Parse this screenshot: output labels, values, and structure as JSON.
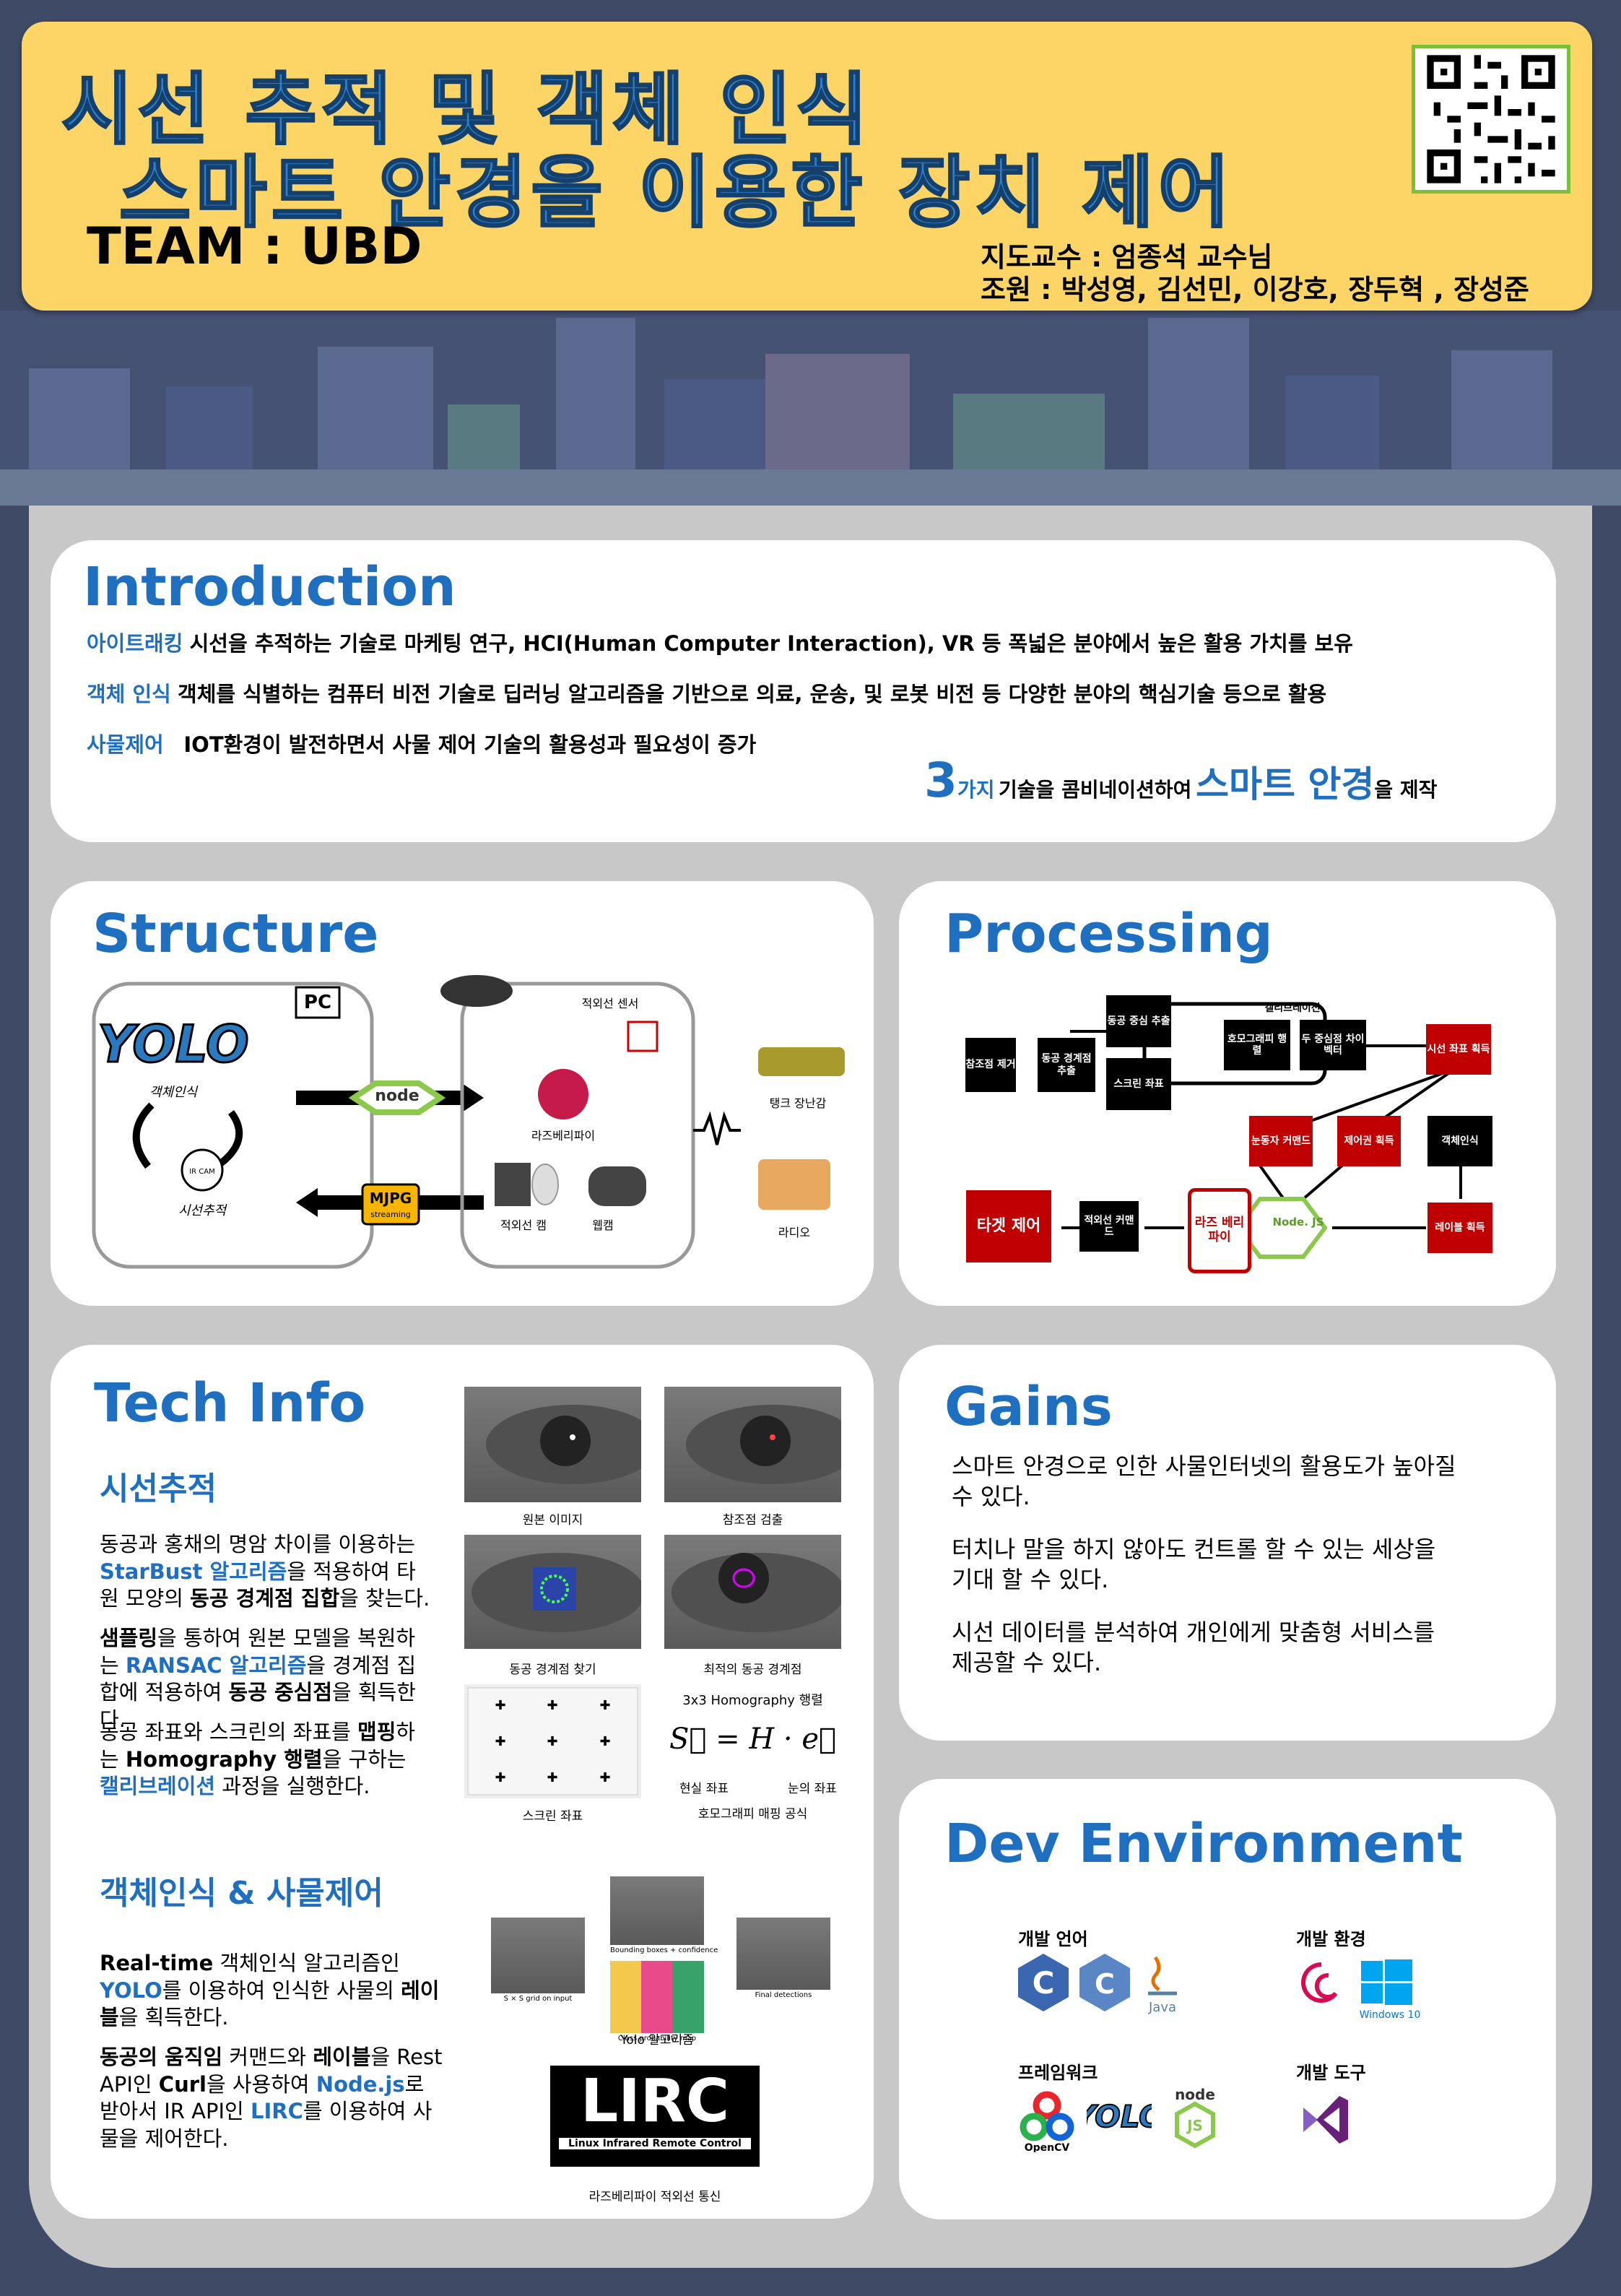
{
  "header": {
    "title_line1": "시선 추적 및 객체 인식",
    "title_line2": "스마트 안경을 이용한 장치 제어",
    "team": "TEAM : UBD",
    "advisor": "지도교수 : 엄종석 교수님",
    "members": "조원 : 박성영, 김선민, 이강호, 장두혁 , 장성준"
  },
  "introduction": {
    "heading": "Introduction",
    "items": [
      {
        "term": "아이트래킹",
        "text": "시선을 추적하는 기술로 마케팅 연구, HCI(Human Computer Interaction), VR 등 폭넓은 분야에서 높은 활용 가치를 보유"
      },
      {
        "term": "객체 인식",
        "text": "객체를 식별하는 컴퓨터 비전 기술로 딥러닝 알고리즘을 기반으로 의료, 운송, 및 로봇 비전 등 다양한 분야의 핵심기술 등으로 활용"
      },
      {
        "term": "사물제어",
        "text": "IOT환경이 발전하면서 사물 제어 기술의 활용성과 필요성이 증가"
      }
    ],
    "summary": {
      "num": "3",
      "unit": "가지",
      "text1": "기술을 콤비네이션하여",
      "highlight": "스마트 안경",
      "text2": "을 제작"
    }
  },
  "structure": {
    "heading": "Structure",
    "pc_label": "PC",
    "yolo_label": "YOLO",
    "object_label": "객체인식",
    "ir_cam_label": "IR CAM",
    "gaze_label": "시선추적",
    "node_label": "node",
    "mjpg_label": "MJPG",
    "mjpg_sub": "streaming",
    "ir_sensor_label": "적외선 센서",
    "raspberry_label": "라즈베리파이",
    "ir_cam2_label": "적외선 캠",
    "webcam_label": "웹캠",
    "tank_label": "탱크 장난감",
    "radio_label": "라디오"
  },
  "processing": {
    "heading": "Processing",
    "boxes": {
      "ref": "참조점 제거",
      "edge": "동공 경계점 추출",
      "center": "동공 중심 추출",
      "screen": "스크린 좌표",
      "calib": "캘리브레이션",
      "homo": "호모그래피 행렬",
      "diff": "두 중심점 차이 벡터",
      "gaze_coord": "시선 좌표 획득",
      "eye_cmd": "눈동자 커맨드",
      "ctrl": "제어권 획득",
      "obj": "객체인식",
      "label": "레이블 획득",
      "node": "Node. JS",
      "rpi": "라즈 베리 파이",
      "ir_cmd": "적외선 커맨드",
      "target": "타겟 제어"
    }
  },
  "tech": {
    "heading": "Tech Info",
    "sub1": "시선추적",
    "p1": [
      " 동공과 홍채의 명암 차이를 이용하는 ",
      "StarBust 알고리즘",
      "을 적용하여 타원 모양의 ",
      "동공 경계점 집합",
      "을 찾는다."
    ],
    "p2": [
      " ",
      "샘플링",
      "을 통하여 원본 모델을 복원하는 ",
      "RANSAC 알고리즘",
      "을 경계점 집합에 적용하여 ",
      "동공 중심점",
      "을 획득한다."
    ],
    "p3": [
      " 동공 좌표와 스크린의 좌표를 ",
      "맵핑",
      "하는 ",
      "Homography 행렬",
      "을 구하는 ",
      "캘리브레이션",
      " 과정을 실행한다."
    ],
    "captions": [
      "원본 이미지",
      "참조점 검출",
      "동공 경계점 찾기",
      "최적의 동공 경계점",
      "스크린 좌표",
      "호모그래피 매핑 공식"
    ],
    "homography_title": "3x3 Homography 행렬",
    "formula": "S⃗ = H · e⃗",
    "formula_left": "현실 좌표",
    "formula_right": "눈의 좌표",
    "sub2": "객체인식 & 사물제어",
    "p4": [
      " ",
      "Real-time",
      " 객체인식 알고리즘인 ",
      "YOLO",
      "를 이용하여 인식한 사물의 ",
      "레이블",
      "을 획득한다."
    ],
    "p5": [
      " ",
      "동공의 움직임",
      " 커맨드와 ",
      "레이블",
      "을 Rest API인 ",
      "Curl",
      "을 사용하여 ",
      "Node.js",
      "로 받아서 IR API인 ",
      "LIRC",
      "를 이용하여 사물을 제어한다."
    ],
    "yolo_caption": "Yolo 알고리즘",
    "yolo_small": [
      "S × S grid on input",
      "Bounding boxes + confidence",
      "Class probability map",
      "Final detections"
    ],
    "lirc_title": "LIRC",
    "lirc_sub": "Linux Infrared Remote Control",
    "lirc_caption": "라즈베리파이 적외선 통신"
  },
  "gains": {
    "heading": "Gains",
    "items": [
      " 스마트 안경으로 인한 사물인터넷의 활용도가 높아질 수 있다.",
      " 터치나 말을 하지 않아도 컨트롤 할 수 있는 세상을 기대 할 수 있다.",
      " 시선 데이터를 분석하여 개인에게 맞춤형 서비스를 제공할 수 있다."
    ]
  },
  "dev": {
    "heading": "Dev Environment",
    "lang_label": "개발 언어",
    "env_label": "개발 환경",
    "fw_label": "프레임워크",
    "tool_label": "개발 도구",
    "java": "Java",
    "win10": "Windows 10",
    "opencv": "OpenCV",
    "yolo": "YOLO",
    "node": "node"
  },
  "colors": {
    "accent_blue": "#1f6fc0",
    "header_yellow": "#fdd567",
    "node_green": "#8cc84b",
    "process_red": "#c00000"
  }
}
